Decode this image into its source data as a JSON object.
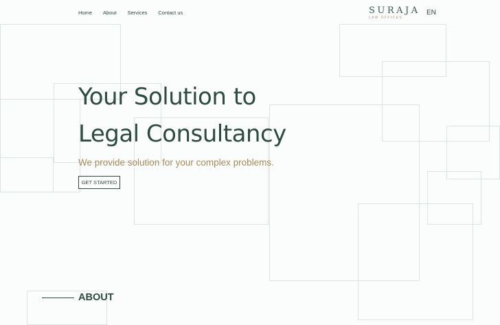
{
  "nav": {
    "items": [
      {
        "label": "Home"
      },
      {
        "label": "About"
      },
      {
        "label": "Services"
      },
      {
        "label": "Contact us"
      }
    ]
  },
  "logo": {
    "main": "SURAJA",
    "sub": "LAW OFFICES"
  },
  "language": "EN",
  "hero": {
    "title_line1": "Your Solution to",
    "title_line2": "Legal Consultancy",
    "subtitle": "We provide solution for your complex problems.",
    "cta_label": "GET STARTED"
  },
  "about": {
    "heading": "ABOUT"
  },
  "colors": {
    "primary": "#2f4a40",
    "accent": "#a88a5a",
    "background": "#fafdfc",
    "outline": "#dde3e0"
  }
}
